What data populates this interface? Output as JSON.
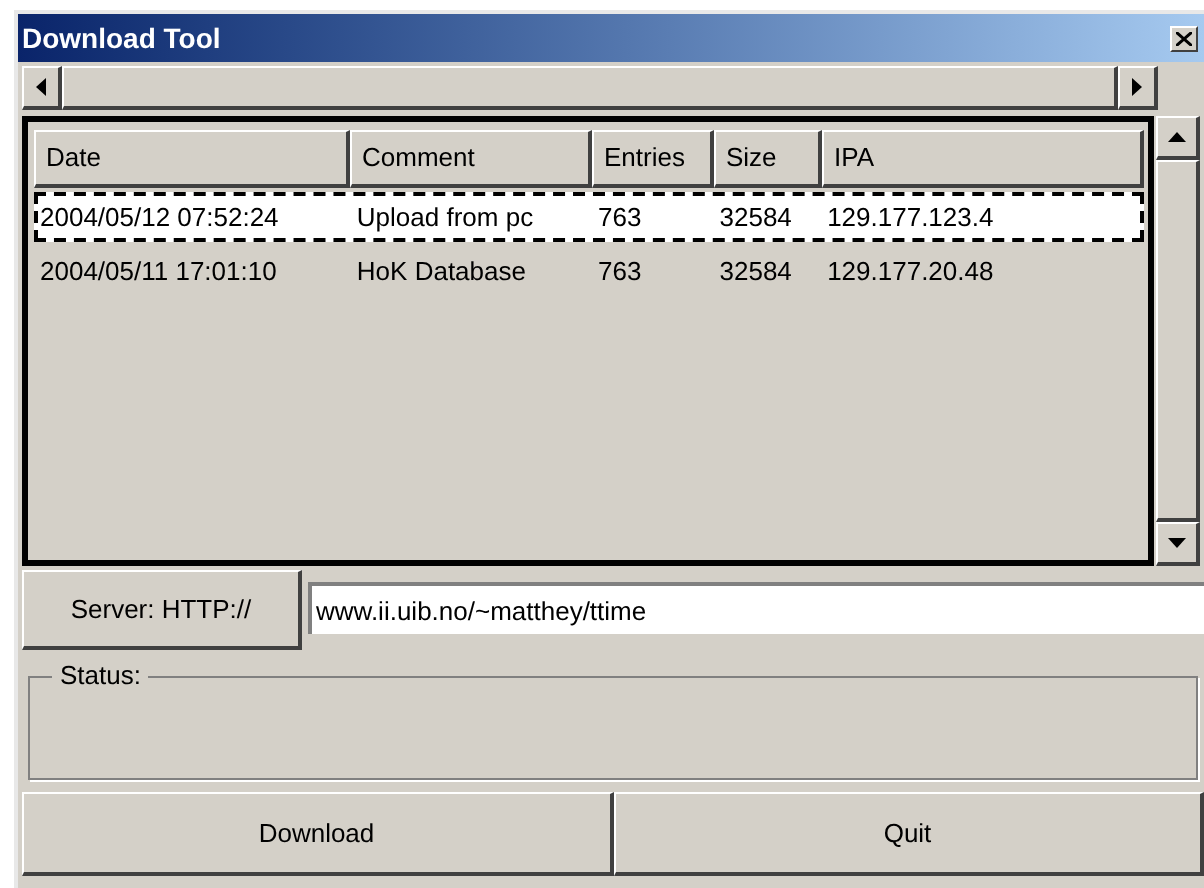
{
  "window": {
    "title": "Download Tool"
  },
  "table": {
    "columns": [
      "Date",
      "Comment",
      "Entries",
      "Size",
      "IPA"
    ],
    "rows": [
      {
        "cells": [
          "2004/05/12 07:52:24",
          "Upload from pc",
          "763",
          "32584",
          "129.177.123.4"
        ],
        "selected": true
      },
      {
        "cells": [
          "2004/05/11 17:01:10",
          "HoK Database",
          "763",
          "32584",
          "129.177.20.48"
        ],
        "selected": false
      }
    ]
  },
  "server": {
    "label": "Server: HTTP://",
    "value": "www.ii.uib.no/~matthey/ttime"
  },
  "status": {
    "label": "Status:"
  },
  "buttons": [
    "Download",
    "Quit"
  ]
}
